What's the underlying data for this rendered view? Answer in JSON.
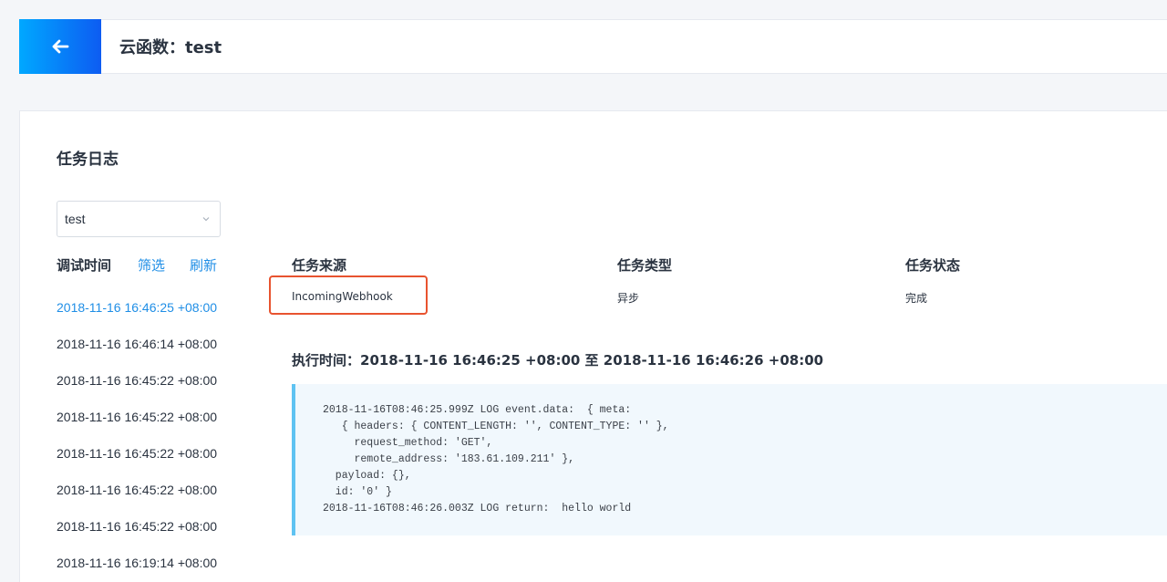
{
  "header": {
    "title": "云函数：test"
  },
  "section": {
    "title": "任务日志"
  },
  "function_select": {
    "value": "test"
  },
  "list_header": {
    "label": "调试时间",
    "filter": "筛选",
    "refresh": "刷新"
  },
  "logs": [
    {
      "time": "2018-11-16 16:46:25 +08:00",
      "active": true
    },
    {
      "time": "2018-11-16 16:46:14 +08:00"
    },
    {
      "time": "2018-11-16 16:45:22 +08:00"
    },
    {
      "time": "2018-11-16 16:45:22 +08:00"
    },
    {
      "time": "2018-11-16 16:45:22 +08:00"
    },
    {
      "time": "2018-11-16 16:45:22 +08:00"
    },
    {
      "time": "2018-11-16 16:45:22 +08:00"
    },
    {
      "time": "2018-11-16 16:19:14 +08:00"
    }
  ],
  "task_info": {
    "source_label": "任务来源",
    "source_value": "IncomingWebhook",
    "type_label": "任务类型",
    "type_value": "异步",
    "status_label": "任务状态",
    "status_value": "完成"
  },
  "execution": {
    "time_text": "执行时间：2018-11-16 16:46:25 +08:00 至 2018-11-16 16:46:26 +08:00"
  },
  "log_output": "2018-11-16T08:46:25.999Z LOG event.data:  { meta:\n   { headers: { CONTENT_LENGTH: '', CONTENT_TYPE: '' },\n     request_method: 'GET',\n     remote_address: '183.61.109.211' },\n  payload: {},\n  id: '0' }\n2018-11-16T08:46:26.003Z LOG return:  hello world",
  "colors": {
    "accent": "#1f8ee6",
    "highlight": "#e8532f",
    "code_border": "#5fc3f2",
    "code_bg": "#f1f8fd"
  },
  "icons": {
    "back": "arrow-left-icon",
    "select": "chevron-down-icon"
  }
}
